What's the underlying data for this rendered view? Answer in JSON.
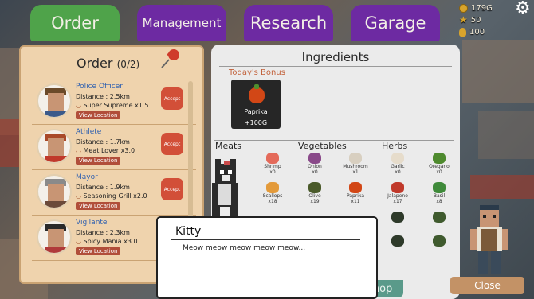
{
  "tabs": [
    "Order",
    "Management",
    "Research",
    "Garage"
  ],
  "currencies": {
    "coins": "179G",
    "stars": "50",
    "research": "100"
  },
  "order_panel": {
    "title": "Order",
    "count": "(0/2)",
    "view_location_label": "View Location",
    "accept_label": "Accept",
    "orders": [
      {
        "name": "Police Officer",
        "distance": "Distance : 2.5km",
        "food": "Super Supreme x1.5"
      },
      {
        "name": "Athlete",
        "distance": "Distance : 1.7km",
        "food": "Meat Lover x3.0"
      },
      {
        "name": "Mayor",
        "distance": "Distance : 1.9km",
        "food": "Seasoning Grill x2.0"
      },
      {
        "name": "Vigilante",
        "distance": "Distance : 2.3km",
        "food": "Spicy Mania x3.0"
      }
    ]
  },
  "ingredients_panel": {
    "title": "Ingredients",
    "bonus_label": "Today's Bonus",
    "bonus": {
      "name": "Paprika",
      "amount": "+100G"
    },
    "categories": [
      "Meats",
      "Vegetables",
      "Herbs"
    ],
    "items": [
      {
        "name": "Shrimp",
        "count": "x0"
      },
      {
        "name": "Onion",
        "count": "x0"
      },
      {
        "name": "Mushroom",
        "count": "x1"
      },
      {
        "name": "Garlic",
        "count": "x0"
      },
      {
        "name": "Oregano",
        "count": "x0"
      },
      {
        "name": "Scallops",
        "count": "x18"
      },
      {
        "name": "Olive",
        "count": "x19"
      },
      {
        "name": "Paprika",
        "count": "x11"
      },
      {
        "name": "Jalapeno",
        "count": "x17"
      },
      {
        "name": "Basil",
        "count": "x8"
      }
    ]
  },
  "buttons": {
    "shop": "Shop",
    "close": "Close"
  },
  "dialog": {
    "speaker": "Kitty",
    "text": "Meow meow meow meow meow..."
  },
  "colors": {
    "tab_active": "#4fa34a",
    "tab_inactive": "#6d2aa2",
    "accept": "#d24f38",
    "bonus_label": "#c2613a"
  }
}
